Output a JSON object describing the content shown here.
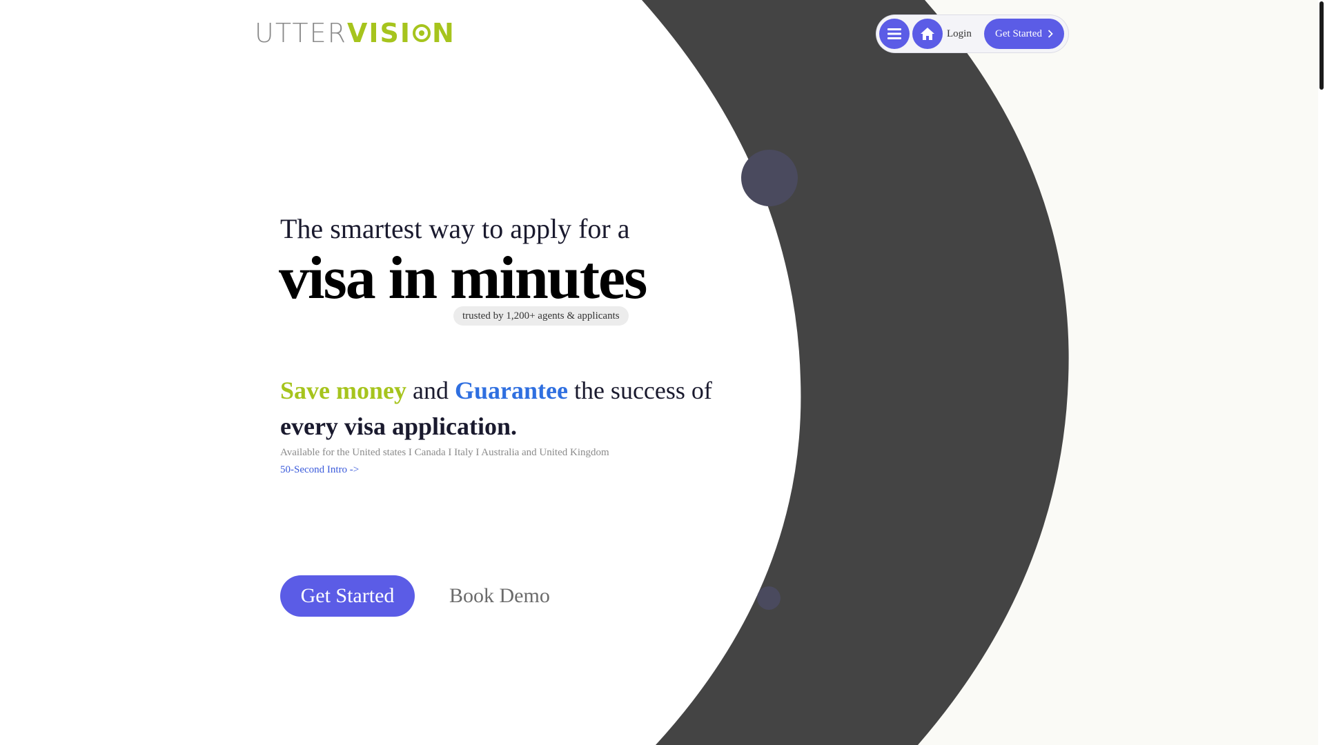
{
  "logo": {
    "part1": "UTTER",
    "part2": "VISI",
    "part3": "N"
  },
  "nav": {
    "login": "Login",
    "cta": "Get Started"
  },
  "hero": {
    "line1": "The smartest way to apply for a",
    "line2": "visa in minutes",
    "trust_badge": "trusted by 1,200+ agents & applicants",
    "tagline": {
      "save": "Save money",
      "and": " and ",
      "guarantee": "Guarantee",
      "rest": " the success of",
      "bold": "every visa application."
    },
    "availability": "Available for the United states I Canada I Italy I Australia and United Kingdom",
    "intro_link": "50-Second Intro ->",
    "cta": "Get Started",
    "demo": "Book Demo"
  },
  "colors": {
    "accent": "#5b5ce6",
    "brand_green": "#a6c41d",
    "brand_blue": "#2f6fe0",
    "ring": "#444444",
    "dot": "#4a4a5e"
  },
  "icons": {
    "menu": "menu-icon",
    "home": "home-icon",
    "chevron": "chevron-right-icon"
  }
}
